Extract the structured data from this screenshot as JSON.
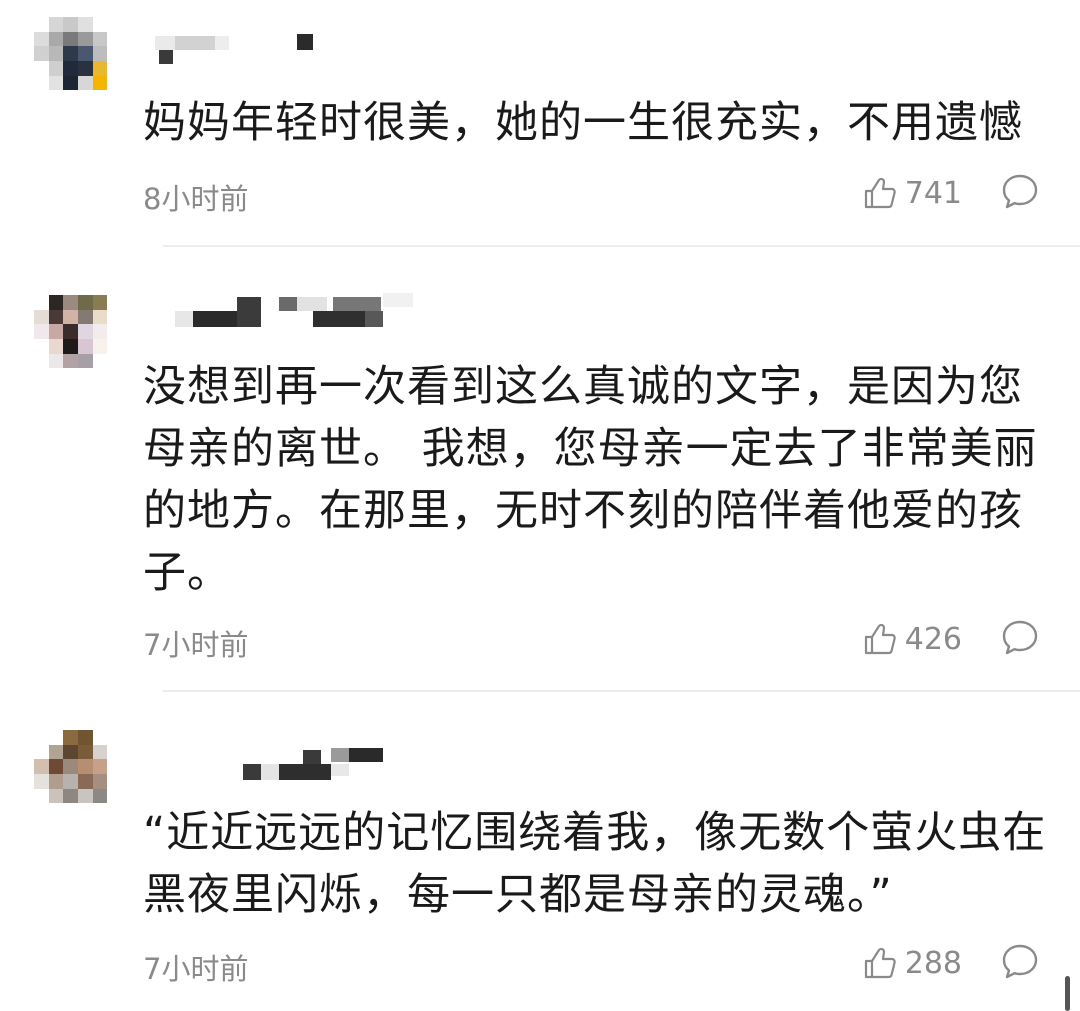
{
  "comments": [
    {
      "text": "妈妈年轻时很美，她的一生很充实，不用遗憾",
      "time": "8小时前",
      "likes": "741"
    },
    {
      "text": "没想到再一次看到这么真诚的文字，是因为您母亲的离世。 我想，您母亲一定去了非常美丽的地方。在那里，无时不刻的陪伴着他爱的孩子。",
      "time": "7小时前",
      "likes": "426"
    },
    {
      "text": "“近近远远的记忆围绕着我，像无数个萤火虫在黑夜里闪烁，每一只都是母亲的灵魂。”",
      "time": "7小时前",
      "likes": "288"
    }
  ],
  "icons": {
    "like": "thumbs-up-icon",
    "reply": "comment-bubble-icon"
  },
  "colors": {
    "text": "#1a1a1a",
    "meta": "#8a8a8a",
    "divider": "#ececec"
  }
}
